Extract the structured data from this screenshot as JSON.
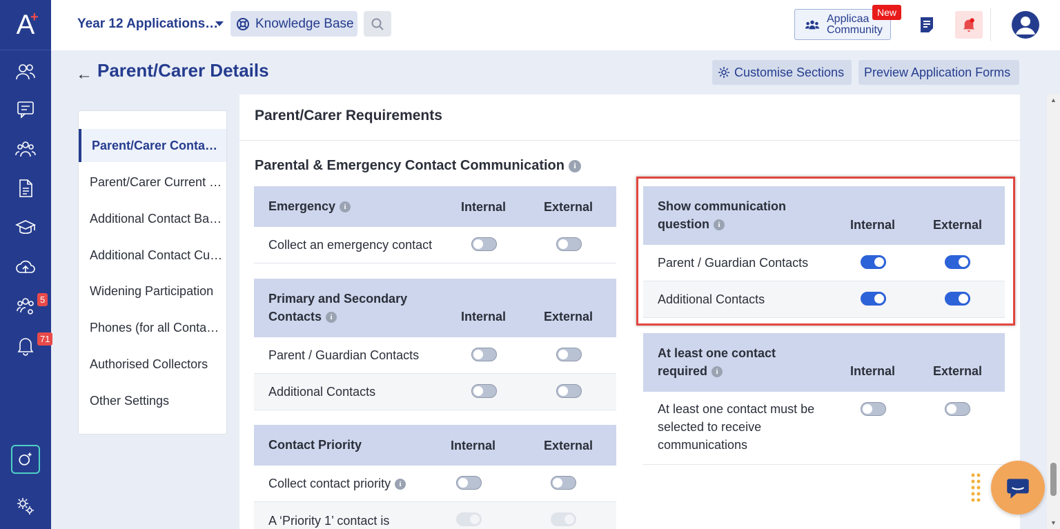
{
  "sidebar": {
    "logo": "A",
    "badges": {
      "groups": "5",
      "notifications": "71"
    },
    "icons": [
      "users-icon",
      "messages-icon",
      "people-icon",
      "document-icon",
      "graduation-icon",
      "cloud-upload-icon",
      "group-settings-icon",
      "bell-icon",
      "add-app-icon",
      "settings-icon"
    ]
  },
  "topbar": {
    "app_title": "Year 12 Applications…",
    "knowledge_base": "Knowledge Base",
    "community_line1": "Applicaa",
    "community_line2": "Community",
    "new_badge": "New"
  },
  "header": {
    "title": "Parent/Carer Details",
    "customise": "Customise Sections",
    "preview": "Preview Application Forms"
  },
  "sections": [
    "Parent/Carer Conta…",
    "Parent/Carer Current …",
    "Additional Contact Ba…",
    "Additional Contact Cu…",
    "Widening Participation",
    "Phones (for all Conta…",
    "Authorised Collectors",
    "Other Settings"
  ],
  "main": {
    "title": "Parent/Carer Requirements",
    "subhead": "Parental & Emergency Contact Communication",
    "col_internal": "Internal",
    "col_external": "External",
    "emergency": {
      "head": "Emergency",
      "rows": [
        {
          "label": "Collect an emergency contact",
          "internal": false,
          "external": false
        }
      ]
    },
    "primary": {
      "head_line1": "Primary and Secondary",
      "head_line2": "Contacts",
      "rows": [
        {
          "label": "Parent / Guardian Contacts",
          "internal": false,
          "external": false
        },
        {
          "label": "Additional Contacts",
          "internal": false,
          "external": false
        }
      ]
    },
    "priority": {
      "head": "Contact Priority",
      "rows": [
        {
          "label": "Collect contact priority",
          "internal": false,
          "external": false
        },
        {
          "label": "A ‘Priority 1’ contact is",
          "internal": "disabled",
          "external": "disabled"
        }
      ]
    },
    "show_comm": {
      "head_line1": "Show communication",
      "head_line2": "question",
      "rows": [
        {
          "label": "Parent / Guardian Contacts",
          "internal": true,
          "external": true
        },
        {
          "label": "Additional Contacts",
          "internal": true,
          "external": true
        }
      ]
    },
    "at_least_one": {
      "head_line1": "At least one contact",
      "head_line2": "required",
      "rows": [
        {
          "label_line1": "At least one contact must be",
          "label_line2": "selected to receive",
          "label_line3": "communications",
          "internal": false,
          "external": false
        }
      ]
    }
  }
}
